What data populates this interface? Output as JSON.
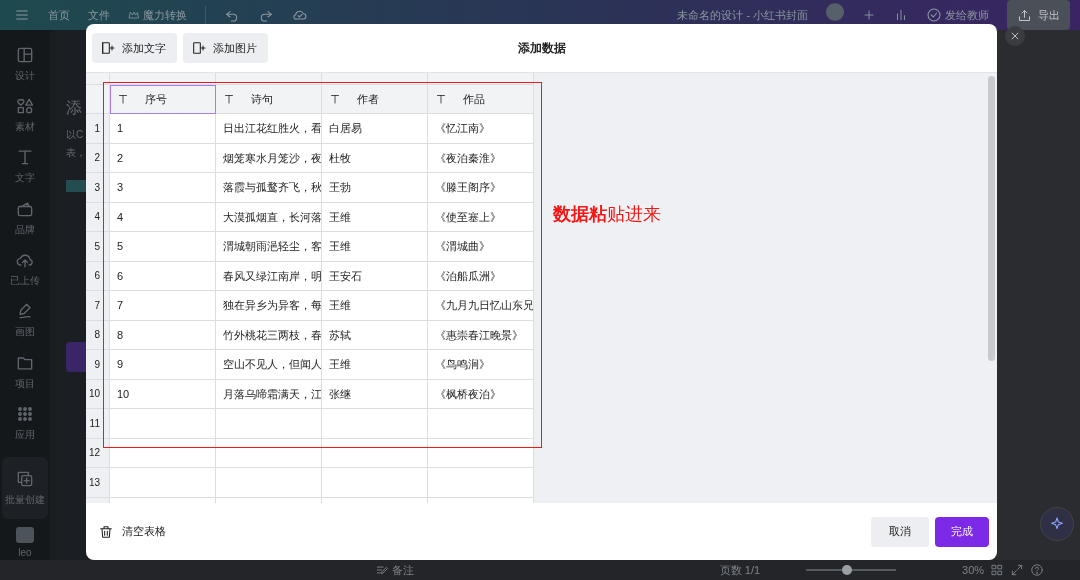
{
  "top_bar": {
    "menu": [
      "首页",
      "文件"
    ],
    "magic_switch": "魔力转换",
    "doc_title": "未命名的设计 - 小红书封面",
    "send_button": "发给教师",
    "export_button": "导出"
  },
  "sidebar": {
    "items": [
      {
        "label": "设计",
        "selected": false
      },
      {
        "label": "素材",
        "selected": false
      },
      {
        "label": "文字",
        "selected": false
      },
      {
        "label": "品牌",
        "selected": false
      },
      {
        "label": "已上传",
        "selected": false
      },
      {
        "label": "画图",
        "selected": false
      },
      {
        "label": "项目",
        "selected": false
      },
      {
        "label": "应用",
        "selected": false
      },
      {
        "label": "批量创建",
        "selected": true
      }
    ],
    "user": "leo"
  },
  "side_panel": {
    "title": "添",
    "lines": [
      "以C",
      "表，"
    ]
  },
  "dialog": {
    "title": "添加数据",
    "toolbar": [
      "添加文字",
      "添加图片"
    ],
    "columns": [
      {
        "label": "序号",
        "selected": true
      },
      {
        "label": "诗句",
        "selected": false
      },
      {
        "label": "作者",
        "selected": false
      },
      {
        "label": "作品",
        "selected": false
      }
    ],
    "rows": [
      {
        "number": "1",
        "cells": [
          "1",
          "日出江花红胜火，看",
          "白居易",
          "《忆江南》"
        ]
      },
      {
        "number": "2",
        "cells": [
          "2",
          "烟笼寒水月笼沙，夜",
          "杜牧",
          "《夜泊秦淮》"
        ]
      },
      {
        "number": "3",
        "cells": [
          "3",
          "落霞与孤鹜齐飞，秋",
          "王勃",
          "《滕王阁序》"
        ]
      },
      {
        "number": "4",
        "cells": [
          "4",
          "大漠孤烟直，长河落",
          "王维",
          "《使至塞上》"
        ]
      },
      {
        "number": "5",
        "cells": [
          "5",
          "渭城朝雨浥轻尘，客",
          "王维",
          "《渭城曲》"
        ]
      },
      {
        "number": "6",
        "cells": [
          "6",
          "春风又绿江南岸，明",
          "王安石",
          "《泊船瓜洲》"
        ]
      },
      {
        "number": "7",
        "cells": [
          "7",
          "独在异乡为异客，每",
          "王维",
          "《九月九日忆山东兄"
        ]
      },
      {
        "number": "8",
        "cells": [
          "8",
          "竹外桃花三两枝，春",
          "苏轼",
          "《惠崇春江晚景》"
        ]
      },
      {
        "number": "9",
        "cells": [
          "9",
          "空山不见人，但闻人",
          "王维",
          "《鸟鸣涧》"
        ]
      },
      {
        "number": "10",
        "cells": [
          "10",
          "月落乌啼霜满天，江",
          "张继",
          "《枫桥夜泊》"
        ]
      },
      {
        "number": "11"
      },
      {
        "number": "12"
      },
      {
        "number": "13"
      }
    ],
    "annotation": "**数据粘**贴进来",
    "clear_button": "清空表格",
    "cancel_button": "取消",
    "done_button": "完成"
  },
  "bottom_bar": {
    "notes": "备注",
    "pages": "页数 1/1",
    "zoom": {
      "level": 0.45,
      "reading": "30%"
    }
  }
}
